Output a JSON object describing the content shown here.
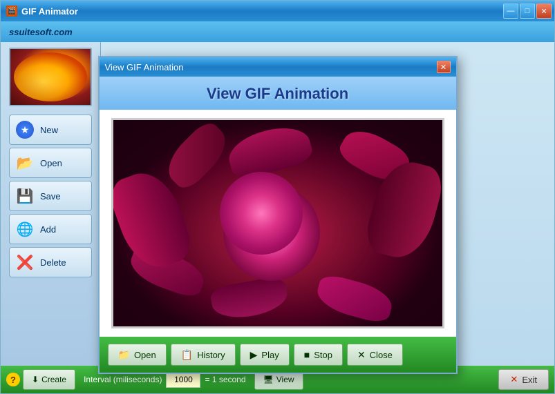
{
  "app": {
    "title": "GIF Animator",
    "brand": "ssuitesoft.com",
    "titlebar_icon": "🎬"
  },
  "titlebar_controls": {
    "minimize_label": "—",
    "maximize_label": "□",
    "close_label": "✕"
  },
  "sidebar": {
    "buttons": [
      {
        "id": "new",
        "label": "New",
        "icon": "🖼"
      },
      {
        "id": "open",
        "label": "Open",
        "icon": "📂"
      },
      {
        "id": "save",
        "label": "Save",
        "icon": "💾"
      },
      {
        "id": "add",
        "label": "Add",
        "icon": "🌐"
      },
      {
        "id": "delete",
        "label": "Delete",
        "icon": "❌"
      }
    ]
  },
  "bottom_bar": {
    "create_label": "Create",
    "interval_label": "Interval (miliseconds)",
    "interval_value": "1000",
    "equals_label": "= 1 second",
    "view_label": "View",
    "exit_label": "Exit",
    "help_label": "?"
  },
  "modal": {
    "title": "View GIF Animation",
    "header_title": "View GIF Animation",
    "buttons": {
      "open_label": "Open",
      "history_label": "History",
      "play_label": "Play",
      "stop_label": "Stop",
      "close_label": "Close"
    }
  }
}
